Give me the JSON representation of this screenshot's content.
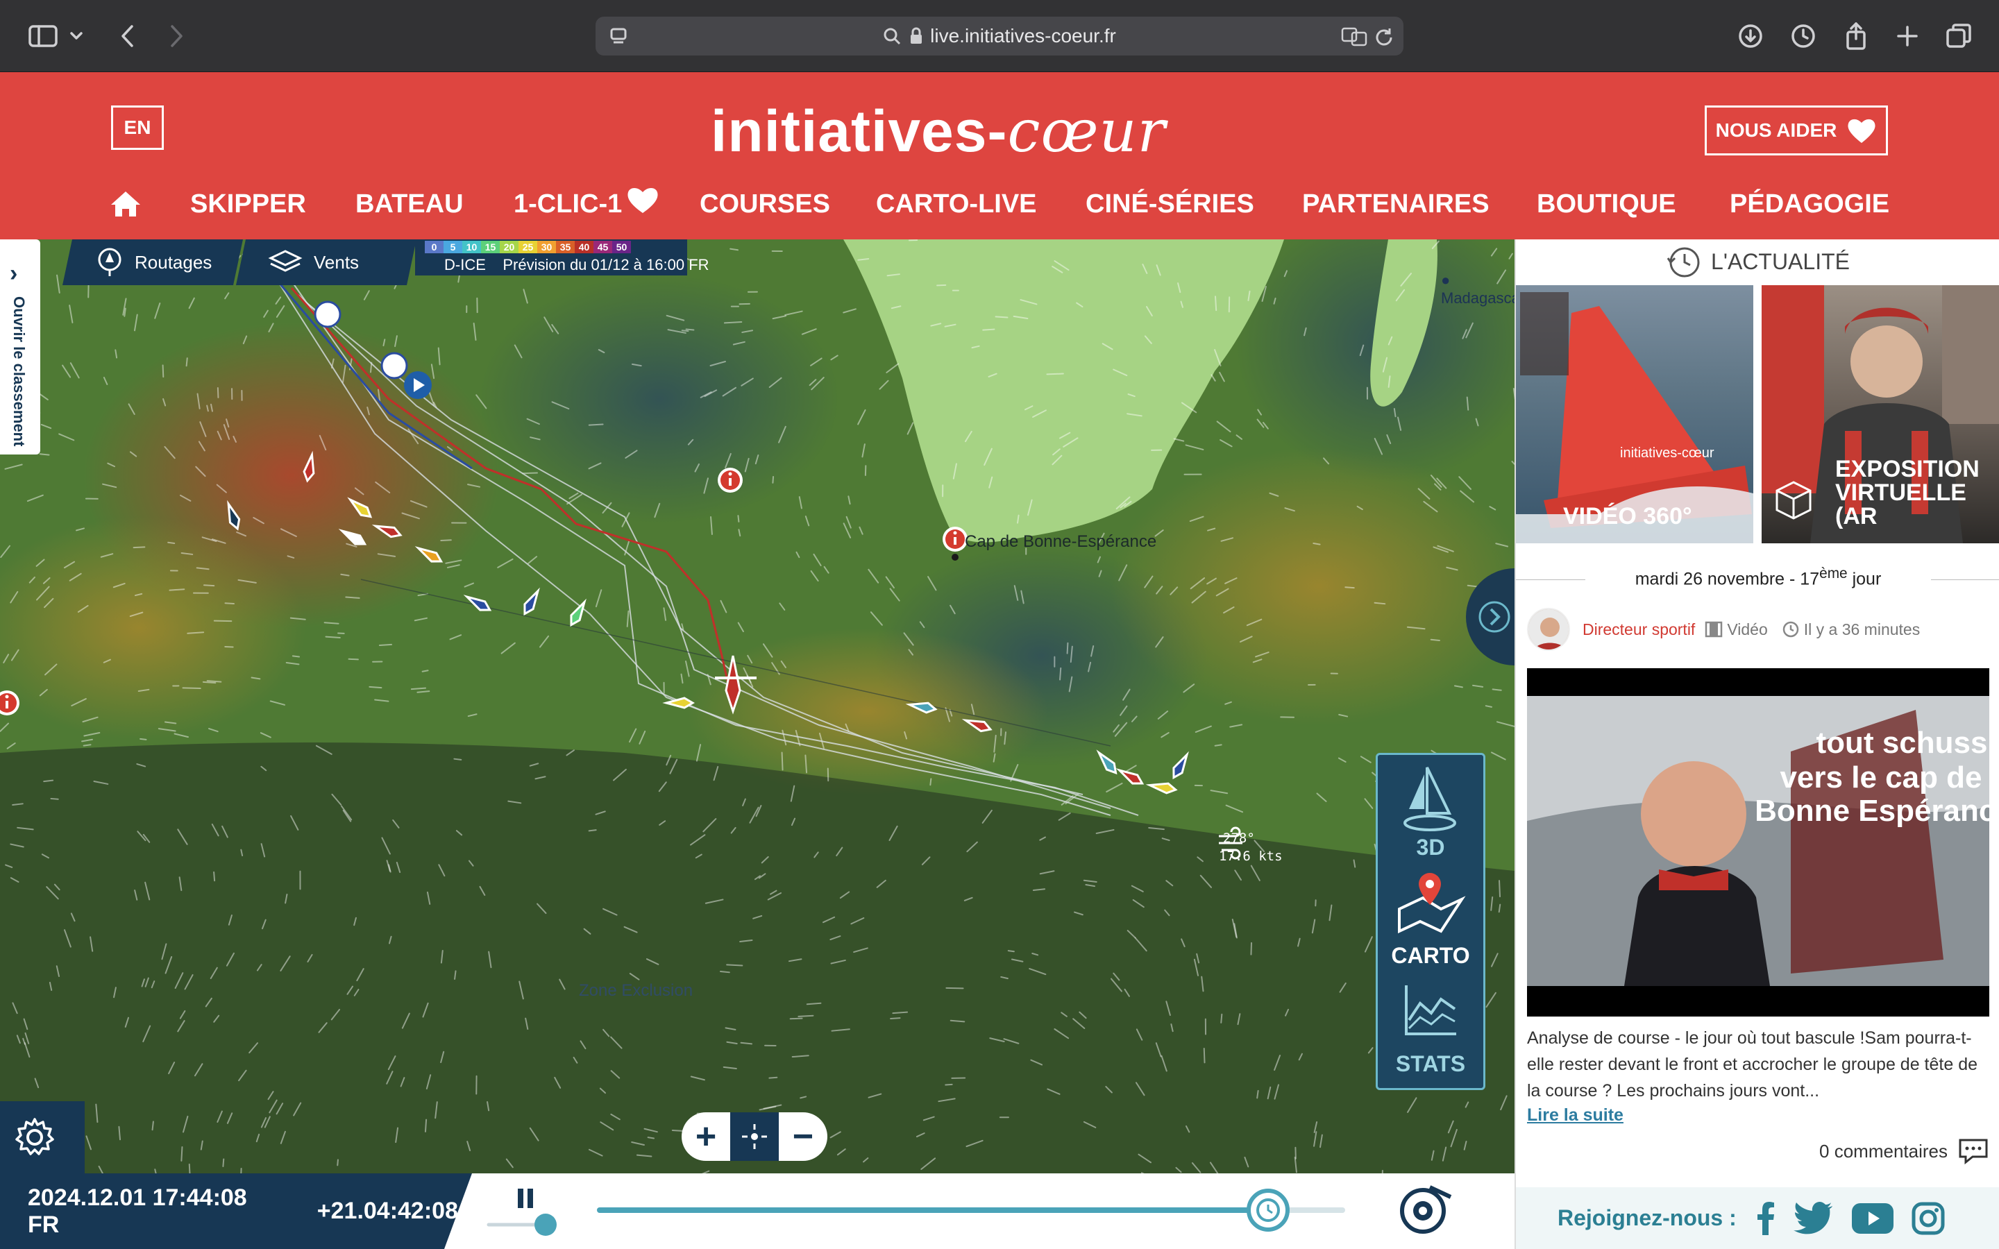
{
  "browser": {
    "url": "live.initiatives-coeur.fr"
  },
  "header": {
    "lang_button": "EN",
    "logo_main": "initiatives-",
    "logo_script": "cœur",
    "help_button": "NOUS AIDER",
    "nav": [
      "SKIPPER",
      "BATEAU",
      "1-CLIC-1",
      "COURSES",
      "CARTO-LIVE",
      "CINÉ-SÉRIES",
      "PARTENAIRES",
      "BOUTIQUE",
      "PÉDAGOGIE"
    ]
  },
  "map": {
    "tools": {
      "routes": "Routages",
      "winds": "Vents"
    },
    "legend": {
      "scale": [
        "0",
        "5",
        "10",
        "15",
        "20",
        "25",
        "30",
        "35",
        "40",
        "45",
        "50"
      ],
      "colors": [
        "#5a78c8",
        "#4aa8e0",
        "#43c3c8",
        "#5cd07a",
        "#a6d64a",
        "#e8d234",
        "#f0a030",
        "#d86028",
        "#b83028",
        "#9a2878",
        "#6a2488"
      ],
      "model": "D-ICE",
      "forecast": "Prévision du 01/12 à 16:00 FR"
    },
    "ranking_tab": "Ouvrir le classement",
    "places": {
      "cape": "Cap de Bonne-Espérance",
      "madagascar": "Madagasca",
      "zone": "Zone Exclusion"
    },
    "wind_readout": {
      "direction": "278°",
      "speed": "17.6 kts"
    },
    "view_buttons": {
      "threeD": "3D",
      "carto": "CARTO",
      "stats": "STATS"
    },
    "zoom": {
      "in": "+",
      "out": "−"
    },
    "datetime": "2024.12.01 17:44:08 FR",
    "elapsed": "+21.04:42:08",
    "timeline_progress": 0.9
  },
  "news": {
    "title": "L'ACTUALITÉ",
    "thumbnails": [
      {
        "label": "VIDÉO 360°"
      },
      {
        "label": "EXPOSITION VIRTUELLE (AR"
      }
    ],
    "day": "mardi 26 novembre - 17",
    "day_sup": "ème",
    "day_suffix": " jour",
    "author": "Directeur sportif",
    "type": "Vidéo",
    "time_ago": "Il y a 36 minutes",
    "video_overlay": [
      "tout schuss",
      "vers le cap de",
      "Bonne Espérance"
    ],
    "excerpt": "Analyse de course - le jour où tout bascule !Sam pourra-t-elle rester devant le front et accrocher le groupe de tête de la course ? Les prochains jours vont...",
    "read_more": "Lire la suite",
    "comments": "0 commentaires",
    "social_label": "Rejoignez-nous :"
  }
}
